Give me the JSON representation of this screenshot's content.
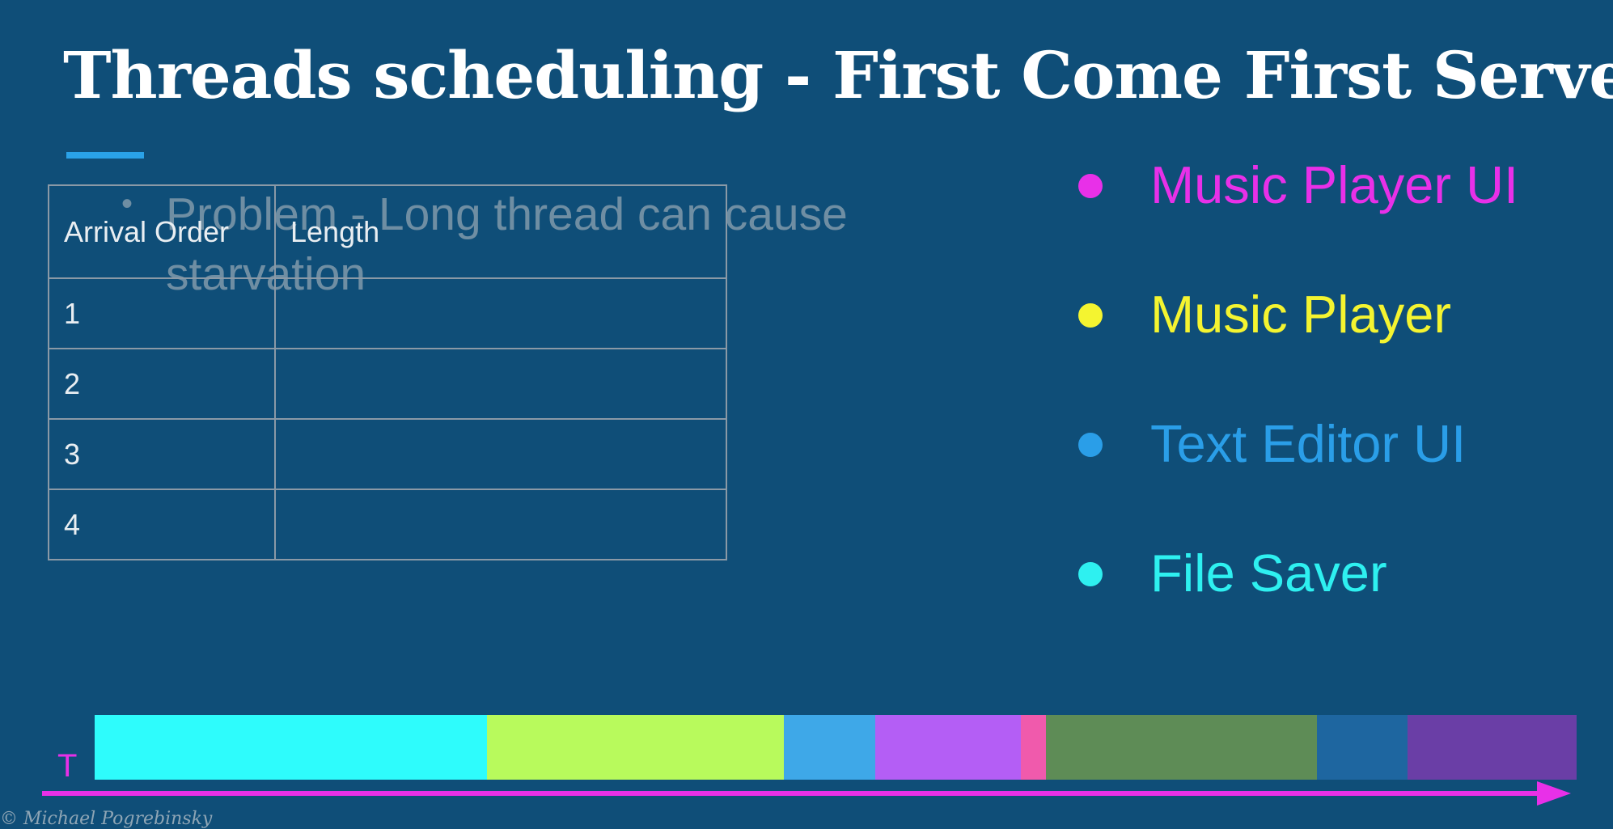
{
  "slide": {
    "title": "Threads scheduling - First Come First Serve",
    "ghost_text": "Problem - Long thread can cause starvation",
    "copyright": "© Michael Pogrebinsky"
  },
  "table": {
    "headers": [
      "Arrival Order",
      "Length"
    ],
    "rows": [
      [
        "1",
        ""
      ],
      [
        "2",
        ""
      ],
      [
        "3",
        ""
      ],
      [
        "4",
        ""
      ]
    ]
  },
  "legend": [
    {
      "label": "Music Player UI",
      "color": "#e830e8"
    },
    {
      "label": "Music Player",
      "color": "#f4f430"
    },
    {
      "label": "Text Editor UI",
      "color": "#2a9ee8"
    },
    {
      "label": "File Saver",
      "color": "#2ef0f0"
    }
  ],
  "timeline": {
    "axis_label": "T",
    "segments": [
      {
        "share": 0.265,
        "color": "#2efcfc"
      },
      {
        "share": 0.2,
        "color": "#b8fa5c"
      },
      {
        "share": 0.062,
        "color": "#3ea8e8"
      },
      {
        "share": 0.098,
        "color": "#b45ef5"
      },
      {
        "share": 0.017,
        "color": "#f05aac"
      },
      {
        "share": 0.183,
        "color": "#5e8c56"
      },
      {
        "share": 0.061,
        "color": "#1e66a0"
      },
      {
        "share": 0.114,
        "color": "#6a3ea6"
      }
    ]
  }
}
